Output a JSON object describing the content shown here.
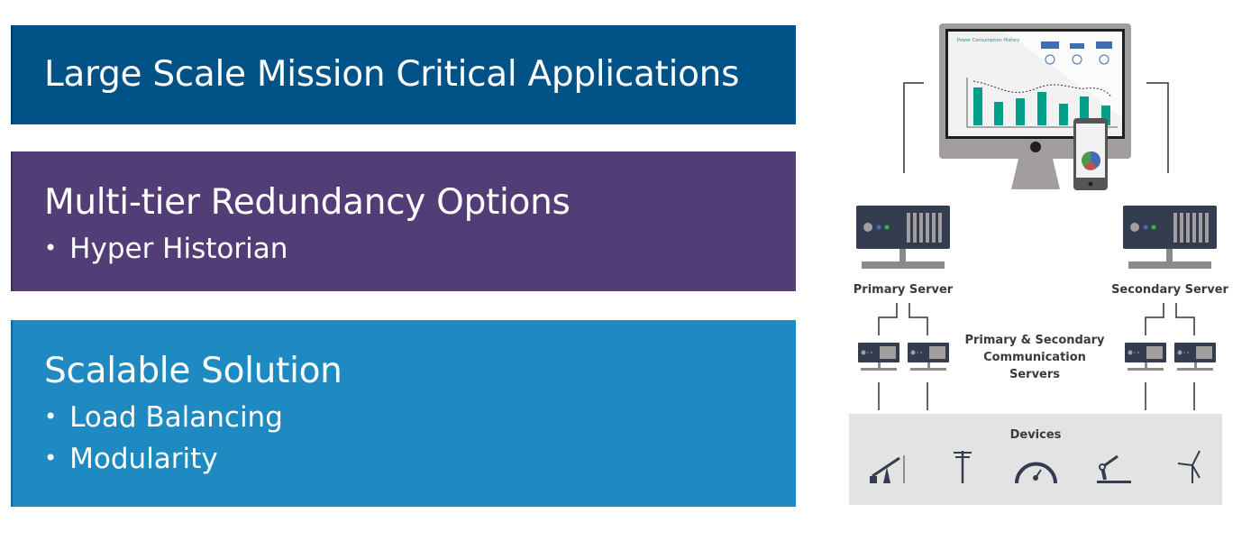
{
  "panels": [
    {
      "title": "Large Scale Mission Critical Applications",
      "bullets": [],
      "color": "#005287"
    },
    {
      "title": "Multi-tier Redundancy Options",
      "bullets": [
        "Hyper Historian"
      ],
      "color": "#523d77"
    },
    {
      "title": "Scalable Solution",
      "bullets": [
        "Load Balancing",
        "Modularity"
      ],
      "color": "#1f8ac1"
    }
  ],
  "diagram": {
    "monitor_title": "Power Consumption History",
    "primary_server": "Primary Server",
    "secondary_server": "Secondary Server",
    "comm_servers": [
      "Primary & Secondary",
      "Communication",
      "Servers"
    ],
    "devices_label": "Devices",
    "device_icons": [
      "oil-pump-icon",
      "power-pole-icon",
      "gauge-icon",
      "robot-arm-icon",
      "wind-turbine-icon"
    ],
    "colors": {
      "server": "#343c4f",
      "bar": "#00a08a",
      "stand": "#8a8a8a",
      "devices_bg": "#e3e3e3"
    }
  }
}
